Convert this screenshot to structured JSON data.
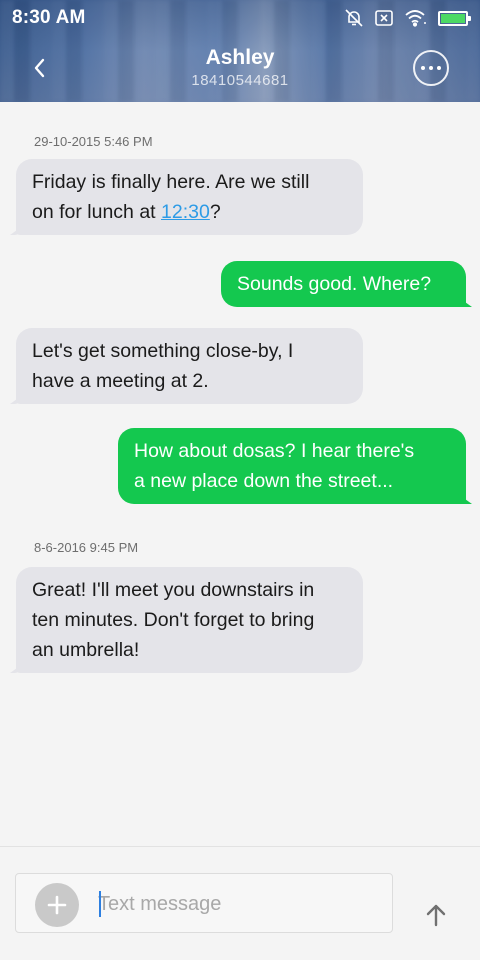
{
  "status_bar": {
    "time": "8:30 AM",
    "icons": [
      "mute-alarm-icon",
      "sim-x-icon",
      "wifi-icon",
      "battery-icon"
    ],
    "battery_color": "#4cd964"
  },
  "header": {
    "contact_name": "Ashley",
    "contact_number": "18410544681",
    "back_icon": "chevron-left-icon",
    "more_icon": "more-horizontal-icon"
  },
  "messages": [
    {
      "type": "timestamp",
      "text": "29-10-2015 5:46 PM"
    },
    {
      "type": "in",
      "lines": [
        "Friday is finally here. Are we still",
        "on for lunch at "
      ],
      "link": "12:30",
      "suffix": "?"
    },
    {
      "type": "out",
      "text": "Sounds good. Where?"
    },
    {
      "type": "in",
      "lines": [
        "Let's get something close-by, I",
        "have a meeting at 2."
      ]
    },
    {
      "type": "out",
      "lines": [
        "How about dosas? I hear there's",
        "a new place down the street..."
      ]
    },
    {
      "type": "timestamp",
      "text": "8-6-2016 9:45 PM"
    },
    {
      "type": "in",
      "lines": [
        "Great! I'll meet you downstairs in",
        "ten minutes. Don't forget to bring",
        "an umbrella!"
      ]
    }
  ],
  "composer": {
    "placeholder": "Text message",
    "add_icon": "plus-icon",
    "send_icon": "arrow-up-icon"
  },
  "colors": {
    "incoming_bubble": "#e4e4e9",
    "outgoing_bubble": "#14c84f",
    "link": "#2d9be6"
  }
}
